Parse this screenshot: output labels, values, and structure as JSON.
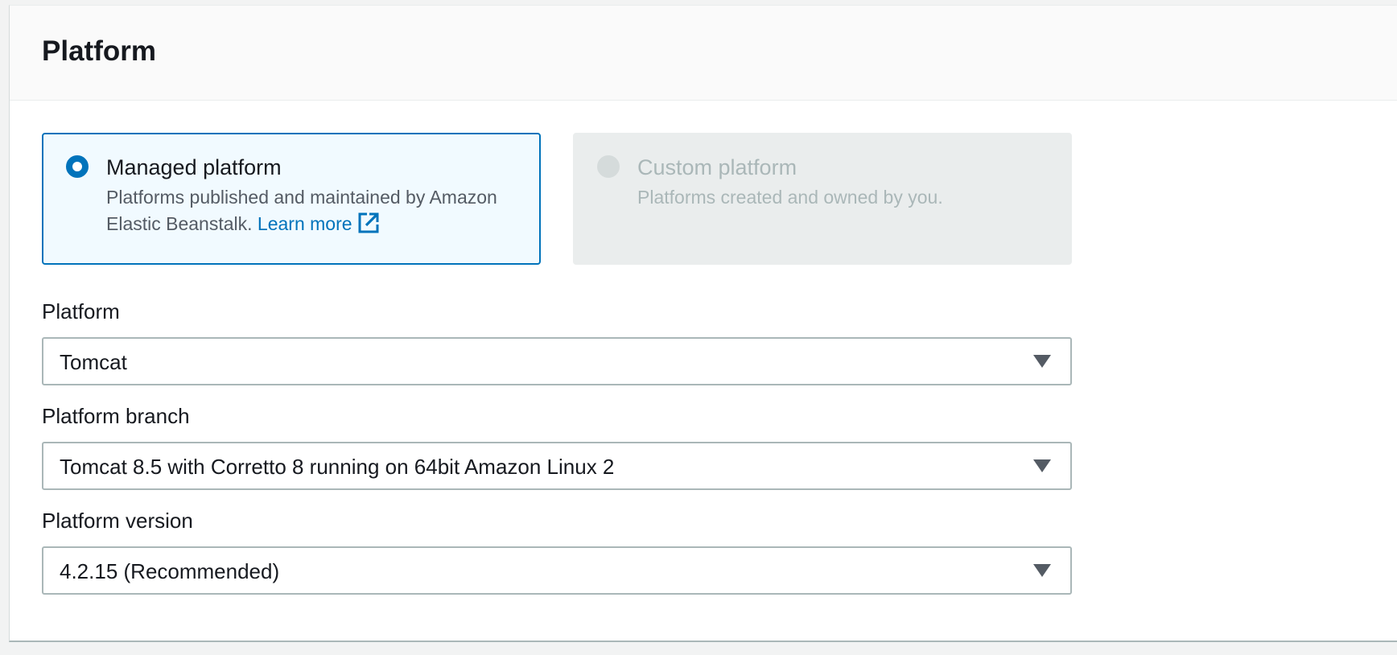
{
  "section": {
    "title": "Platform"
  },
  "platform_type": {
    "managed": {
      "title": "Managed platform",
      "description": "Platforms published and maintained by Amazon Elastic Beanstalk.",
      "link": "Learn more",
      "link_icon": "external-link-icon",
      "selected": true
    },
    "custom": {
      "title": "Custom platform",
      "description": "Platforms created and owned by you.",
      "disabled": true
    }
  },
  "fields": {
    "platform": {
      "label": "Platform",
      "value": "Tomcat"
    },
    "branch": {
      "label": "Platform branch",
      "value": "Tomcat 8.5 with Corretto 8 running on 64bit Amazon Linux 2"
    },
    "version": {
      "label": "Platform version",
      "value": "4.2.15 (Recommended)"
    }
  },
  "colors": {
    "accent": "#0073bb",
    "selected_tile_bg": "#f1faff",
    "disabled_tile_bg": "#eaeded",
    "border": "#aab7b8"
  }
}
